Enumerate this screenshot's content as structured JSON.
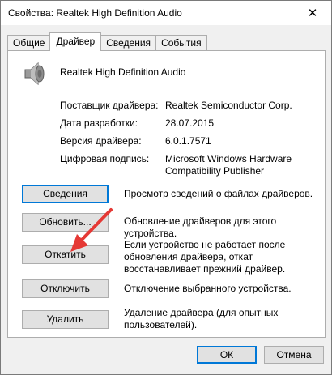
{
  "window": {
    "title": "Свойства: Realtek High Definition Audio",
    "close_glyph": "✕"
  },
  "tabs": [
    {
      "label": "Общие"
    },
    {
      "label": "Драйвер",
      "active": true
    },
    {
      "label": "Сведения"
    },
    {
      "label": "События"
    }
  ],
  "device": {
    "name": "Realtek High Definition Audio",
    "icon": "speaker-icon"
  },
  "driver_info": {
    "provider_label": "Поставщик драйвера:",
    "provider_value": "Realtek Semiconductor Corp.",
    "date_label": "Дата разработки:",
    "date_value": "28.07.2015",
    "version_label": "Версия драйвера:",
    "version_value": "6.0.1.7571",
    "signature_label": "Цифровая подпись:",
    "signature_value": "Microsoft Windows Hardware Compatibility Publisher"
  },
  "actions": {
    "details_label": "Сведения",
    "details_desc": "Просмотр сведений о файлах драйверов.",
    "update_label": "Обновить...",
    "update_desc": "Обновление драйверов для этого устройства.",
    "rollback_label": "Откатить",
    "rollback_desc": "Если устройство не работает после обновления драйвера, откат восстанавливает прежний драйвер.",
    "disable_label": "Отключить",
    "disable_desc": "Отключение выбранного устройства.",
    "uninstall_label": "Удалить",
    "uninstall_desc": "Удаление драйвера (для опытных пользователей)."
  },
  "footer": {
    "ok_label": "ОК",
    "cancel_label": "Отмена"
  },
  "colors": {
    "accent": "#0078d7",
    "arrow": "#e53935"
  }
}
